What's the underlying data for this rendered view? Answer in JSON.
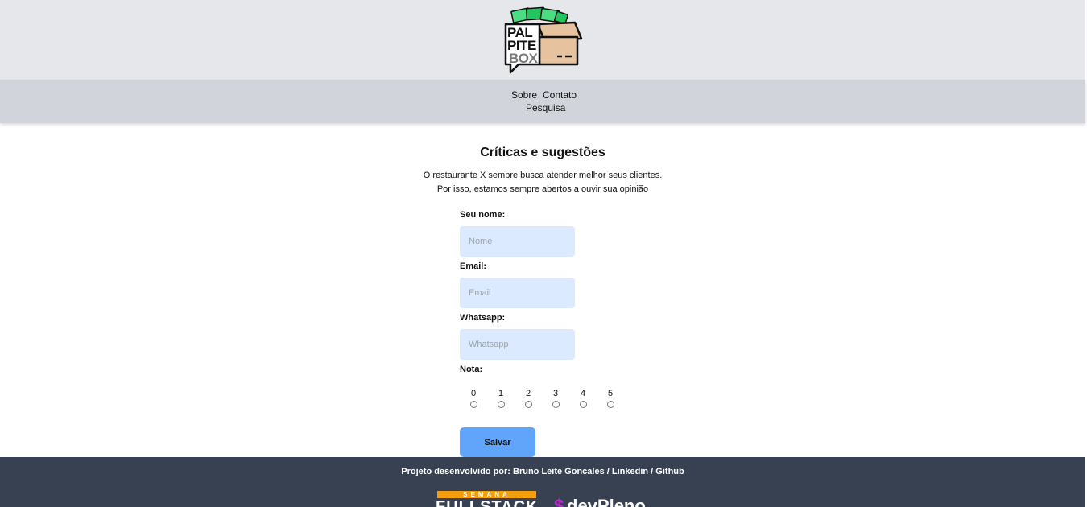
{
  "logo": {
    "line1": "PAL",
    "line2": "PITE",
    "line3": "BOX"
  },
  "nav": {
    "items": [
      "Sobre",
      "Contato",
      "Pesquisa"
    ]
  },
  "main": {
    "title": "Críticas e sugestões",
    "description": [
      "O restaurante X sempre busca atender melhor seus clientes.",
      "Por isso, estamos sempre abertos a ouvir sua opinião"
    ]
  },
  "form": {
    "name": {
      "label": "Seu nome:",
      "placeholder": "Nome",
      "value": ""
    },
    "email": {
      "label": "Email:",
      "placeholder": "Email",
      "value": ""
    },
    "whatsapp": {
      "label": "Whatsapp:",
      "placeholder": "Whatsapp",
      "value": ""
    },
    "nota": {
      "label": "Nota:",
      "options": [
        "0",
        "1",
        "2",
        "3",
        "4",
        "5"
      ]
    },
    "save_label": "Salvar"
  },
  "footer": {
    "credit_prefix": "Projeto desenvolvido por: ",
    "author": "Bruno Leite Goncales",
    "sep1": " / ",
    "linkedin": "Linkedin",
    "sep2": " / ",
    "github": "Github",
    "sponsor1_small": "SEMANA",
    "sponsor1_big": "FULLSTACK",
    "sponsor2_symbol": "$",
    "sponsor2_text": "devPleno"
  },
  "colors": {
    "header_bg": "#e5e7eb",
    "nav_bg": "#d1d5db",
    "input_bg": "#dbeafe",
    "button_bg": "#60a5fa",
    "footer_bg": "#374151",
    "brand_orange": "#f59e0b",
    "brand_magenta": "#c026d3"
  }
}
